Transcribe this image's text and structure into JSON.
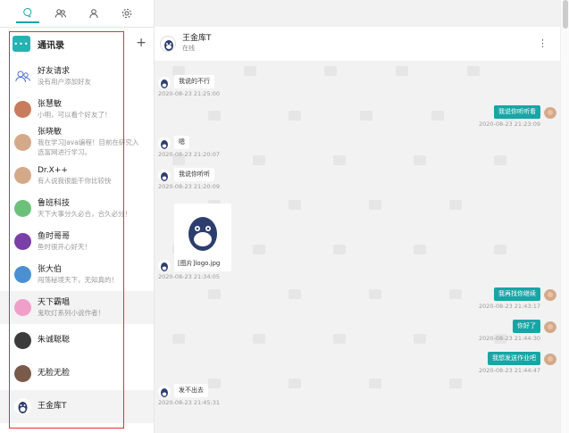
{
  "nav": {
    "icons": [
      "chat-icon",
      "contacts-icon",
      "user-icon",
      "settings-icon"
    ]
  },
  "contacts": {
    "title": "通讯录",
    "add_label": "+",
    "items": [
      {
        "name": "好友请求",
        "msg": "没有用户添加好友",
        "avatar": "friends-request-icon",
        "color": "#ffffff"
      },
      {
        "name": "张慧敏",
        "msg": "小明，可以看个好友了！",
        "avatar": "girl",
        "color": "#c97c5d"
      },
      {
        "name": "张晓敏",
        "msg": "我在学习Java编程！目前在研究入选富网进行学习。",
        "avatar": "default",
        "color": "#d4a98a"
      },
      {
        "name": "Dr.X++",
        "msg": "有人说我很能干你比较快",
        "avatar": "default",
        "color": "#d4a98a"
      },
      {
        "name": "鲁班科技",
        "msg": "天下大事分久必合，合久必分！",
        "avatar": "green",
        "color": "#6cc17a"
      },
      {
        "name": "鱼时哥哥",
        "msg": "鱼时很开心好天！",
        "avatar": "purple",
        "color": "#7b3fa8"
      },
      {
        "name": "张大伯",
        "msg": "闯荡秘境天下，无知真的！",
        "avatar": "blue",
        "color": "#4a8fd1"
      },
      {
        "name": "天下霸唱",
        "msg": "鬼吹灯系列小说作者！",
        "avatar": "pink",
        "color": "#f0a0c8"
      },
      {
        "name": "朱诚聪聪",
        "msg": "",
        "avatar": "dark",
        "color": "#3b3b3b"
      },
      {
        "name": "无脸无脸",
        "msg": "",
        "avatar": "dark2",
        "color": "#7a5a4a"
      },
      {
        "name": "王金库T",
        "msg": "",
        "avatar": "monkey",
        "color": "#2d3e6e"
      }
    ]
  },
  "chat": {
    "name": "王金库T",
    "status": "在线",
    "more_label": "⋮",
    "messages": [
      {
        "side": "right",
        "text": "",
        "time": "2020-08-23 21:18:40"
      },
      {
        "side": "left",
        "text": "我说的不行",
        "time": "2020-08-23 21:25:00"
      },
      {
        "side": "right",
        "text": "我说你听听看",
        "time": "2020-08-23 21:23:09"
      },
      {
        "side": "left",
        "text": "嗯",
        "time": "2020-08-23 21:20:07"
      },
      {
        "side": "left",
        "text": "我说你听听",
        "time": "2020-08-23 21:20:09"
      },
      {
        "side": "left",
        "image_caption": "[图片]logo.jpg",
        "time": "2020-08-23 21:34:05"
      },
      {
        "side": "right",
        "text": "我再找你继续",
        "time": "2020-08-23 21:43:17"
      },
      {
        "side": "right",
        "text": "你好了",
        "time": "2020-08-23 21:44:30"
      },
      {
        "side": "right",
        "text": "我想发送作业吧",
        "time": "2020-08-23 21:44:47"
      },
      {
        "side": "left",
        "text": "发不出去",
        "time": "2020-08-23 21:45:31"
      }
    ]
  }
}
